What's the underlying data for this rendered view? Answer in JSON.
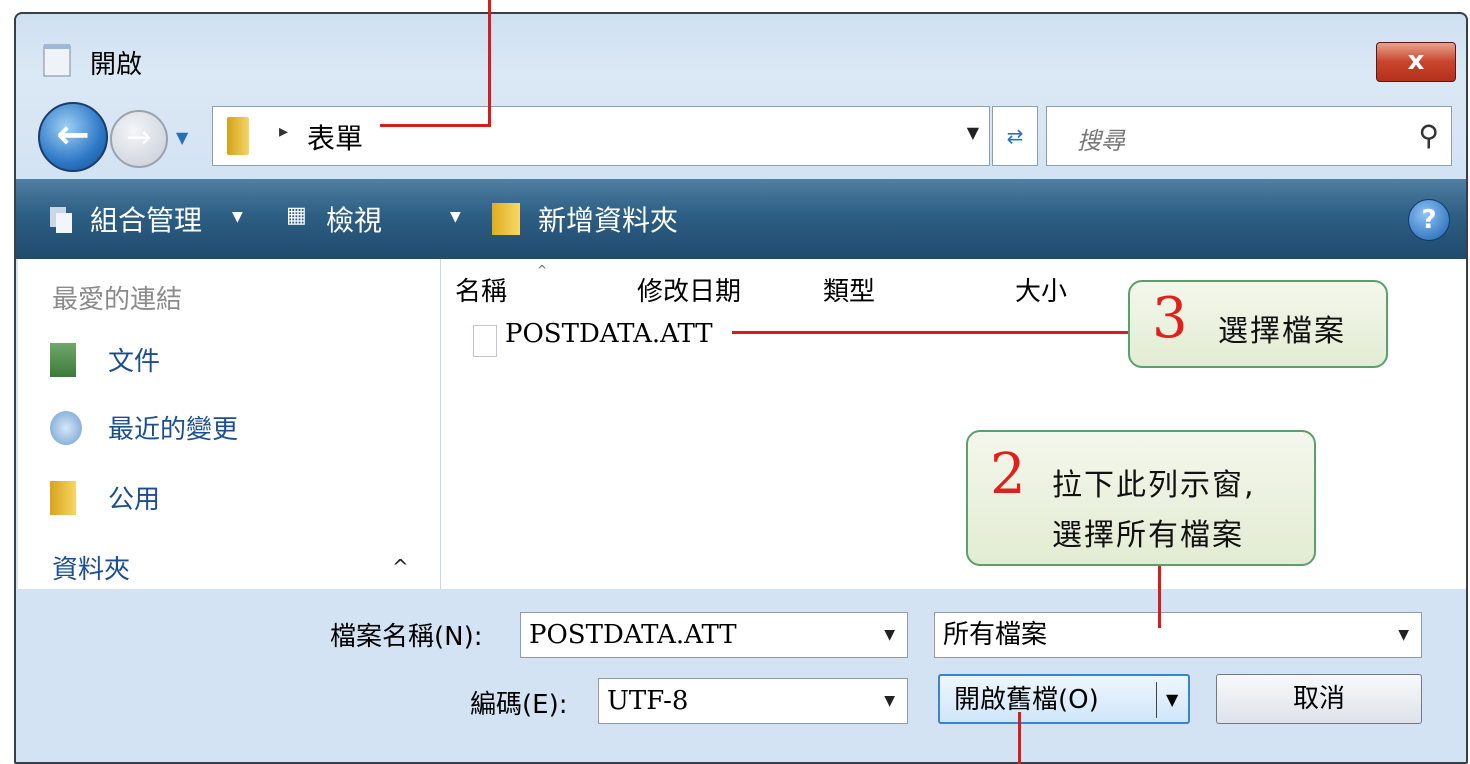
{
  "window": {
    "title": "開啟",
    "close_label": "x"
  },
  "nav": {
    "folder": "表單",
    "search_placeholder": "搜尋"
  },
  "toolbar": {
    "organize": "組合管理",
    "view": "檢視",
    "new_folder": "新增資料夾",
    "help": "?"
  },
  "sidebar": {
    "favorites_header": "最愛的連結",
    "items": [
      {
        "label": "文件",
        "icon": "documents-icon"
      },
      {
        "label": "最近的變更",
        "icon": "recent-changes-icon"
      },
      {
        "label": "公用",
        "icon": "public-folder-icon"
      }
    ],
    "folders_header": "資料夾",
    "folders_toggle": "^"
  },
  "filelist": {
    "columns": [
      "名稱",
      "修改日期",
      "類型",
      "大小"
    ],
    "sort_indicator": "^",
    "files": [
      {
        "name": "POSTDATA.ATT"
      }
    ]
  },
  "form": {
    "filename_label": "檔案名稱(N):",
    "filename_value": "POSTDATA.ATT",
    "filetype_value": "所有檔案",
    "encoding_label": "編碼(E):",
    "encoding_value": "UTF-8",
    "open_button": "開啟舊檔(O)",
    "cancel_button": "取消"
  },
  "annotations": [
    {
      "number": "3",
      "text": "選擇檔案"
    },
    {
      "number": "2",
      "line1": "拉下此列示窗,",
      "line2": "選擇所有檔案"
    }
  ]
}
